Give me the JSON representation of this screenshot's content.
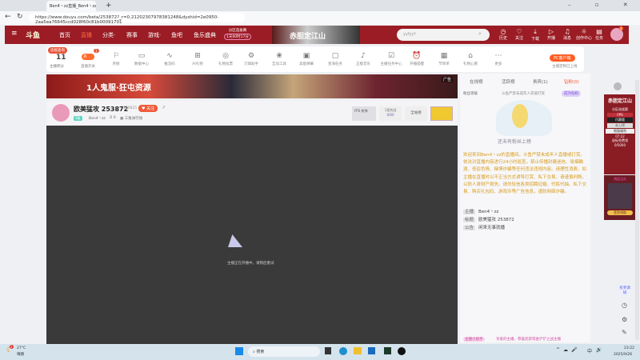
{
  "browser": {
    "tab_title": "Ben4丶zz直播_Ben4丶zz直播_Ben4丶",
    "url": "https://www.douyu.com/beta/253872?_r=0.21202307978381248&dyshid=2e0950-2aa5ea76645ccd028f60c81b00091701"
  },
  "nav": {
    "logo": "斗鱼",
    "items": [
      "首页",
      "直播",
      "分类·",
      "赛事",
      "游戏·",
      "鱼吧",
      "鱼乐盛典"
    ],
    "promo_top": "分区选拔赛",
    "promo_bottom": "1天00时17分",
    "banner_text": "赤胆定江山",
    "search_value": "yyfyyf",
    "right": [
      "历史",
      "关注",
      "下载",
      "开播",
      "消息",
      "创作中心",
      "任务"
    ],
    "avatar_badge": "1"
  },
  "toolbar": {
    "score_badge": "违规查询",
    "score_value": "11",
    "score_label": "主播积分",
    "live_badge": "1",
    "live_toggle": "开",
    "items": [
      "直播开关",
      "月榜",
      "数据中心",
      "推流码",
      "AI礼物",
      "礼物投票",
      "刀锋助手",
      "互动工具",
      "高能弹幕",
      "星海任务",
      "正版音乐",
      "主播任务中心",
      "开播提醒",
      "节目单",
      "礼物心愿",
      "更多"
    ],
    "pc_button": "PC客户端",
    "pc_sub": "主播定制已上线"
  },
  "ad": {
    "text": "1人鬼服·狂屯资源",
    "label": "广告"
  },
  "streamer": {
    "title": "欧美猛攻 253872",
    "room_id": "110825",
    "follow": "关注",
    "level": "2级",
    "name": "Ben4丶zz",
    "likes": "0",
    "category": "三角洲行动",
    "fps_label": "FPS 射弹",
    "fans_label": "1星热战",
    "fans_count": "0/60",
    "site_rank": "全站榜"
  },
  "video": {
    "status": "主播正在开播中，请稍后重试"
  },
  "panel": {
    "tabs": [
      "在线榜",
      "活跃榜",
      "贵宾(1)",
      "钻粉(0)"
    ],
    "fan_level": "粉丝等级",
    "fan_notice": "斗鱼严禁未成年人充值打赏",
    "become_fan": "成为钻粉",
    "empty": "还未有粉丝上榜",
    "notice": "欢迎来到Ben4丶zz的直播间。斗鱼严禁未成年人直播或打赏。依法对直播内容进行24小时巡查，禁止传播封建迷信、吸烟酗酒、低俗色情、赌博诈骗等任何违法违规内容。请理性消费，如主播在直播时以不正当方式诱导打赏、私下交易，请谨慎判断，以防人身财产损失。请勿轻信各类招聘征婚、代练代抽、私下交易、购买礼包码、游戏币等广告信息，谨防网络诈骗。",
    "info": [
      {
        "k": "主播",
        "v": "Ben4丶zz"
      },
      {
        "k": "标题",
        "v": "欧美猛攻 253872"
      },
      {
        "k": "公告",
        "v": "闲来无事就播"
      }
    ],
    "assistant_tag": "主播小助手",
    "assistant_msg": "亲爱的主播，恭喜您获得金铲铲之战主播"
  },
  "side": {
    "ad1_title": "赤胆定江山",
    "ad1_a": "分区选拔赛",
    "ad1_b": "FPS",
    "ad1_c": "巧赛版",
    "ad1_d": "未上榜",
    "ad1_e": "限量福利",
    "ad1_f": "07:22",
    "ad1_g": "鼠标免费领",
    "ad1_h": "0/5000",
    "ad2_title": "鸿运当头",
    "ad2_btn": "签到领取",
    "survey": "有奖调研"
  },
  "taskbar": {
    "temp": "27°C",
    "weather": "晴朗",
    "weather_badge": "2",
    "search": "搜索",
    "ime": "中",
    "time": "23:22",
    "date": "2025/9/26"
  },
  "colors": {
    "brand": "#9b1c24",
    "accent": "#ff5d23",
    "notice": "#d89b1a"
  }
}
